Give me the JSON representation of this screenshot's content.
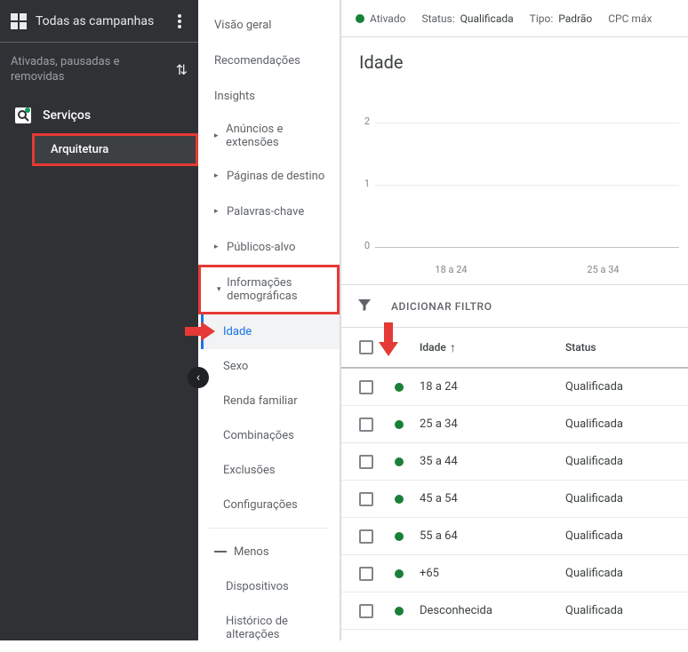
{
  "sidebar_dark": {
    "title": "Todas as campanhas",
    "subheader": "Ativadas, pausadas e removidas",
    "item_services": "Serviços",
    "item_arquitetura": "Arquitetura"
  },
  "panel_light": {
    "items": [
      {
        "label": "Visão geral",
        "arrow": false
      },
      {
        "label": "Recomendações",
        "arrow": false
      },
      {
        "label": "Insights",
        "arrow": false
      },
      {
        "label": "Anúncios e extensões",
        "arrow": true
      },
      {
        "label": "Páginas de destino",
        "arrow": true
      },
      {
        "label": "Palavras-chave",
        "arrow": true
      },
      {
        "label": "Públicos-alvo",
        "arrow": true
      }
    ],
    "demographics_label": "Informações demográficas",
    "subs": [
      {
        "label": "Idade"
      },
      {
        "label": "Sexo"
      },
      {
        "label": "Renda familiar"
      },
      {
        "label": "Combinações"
      },
      {
        "label": "Exclusões"
      },
      {
        "label": "Configurações"
      }
    ],
    "menos": "Menos",
    "more_items": [
      {
        "label": "Dispositivos"
      },
      {
        "label": "Histórico de alterações"
      }
    ]
  },
  "main": {
    "status": {
      "enabled_label": "Ativado",
      "status_label": "Status:",
      "status_value": "Qualificada",
      "type_label": "Tipo:",
      "type_value": "Padrão",
      "cpc_label": "CPC máx"
    },
    "title": "Idade",
    "filter_label": "ADICIONAR FILTRO",
    "table_header": {
      "col_age": "Idade",
      "col_status": "Status"
    },
    "rows": [
      {
        "age": "18 a 24",
        "status": "Qualificada"
      },
      {
        "age": "25 a 34",
        "status": "Qualificada"
      },
      {
        "age": "35 a 44",
        "status": "Qualificada"
      },
      {
        "age": "45 a 54",
        "status": "Qualificada"
      },
      {
        "age": "55 a 64",
        "status": "Qualificada"
      },
      {
        "age": "+65",
        "status": "Qualificada"
      },
      {
        "age": "Desconhecida",
        "status": "Qualificada"
      }
    ]
  },
  "chart_data": {
    "type": "line",
    "categories": [
      "18 a 24",
      "25 a 34"
    ],
    "values": [
      0,
      0
    ],
    "xlabel": "",
    "ylabel": "",
    "ylim": [
      0,
      2
    ],
    "yticks": [
      0,
      1,
      2
    ]
  }
}
